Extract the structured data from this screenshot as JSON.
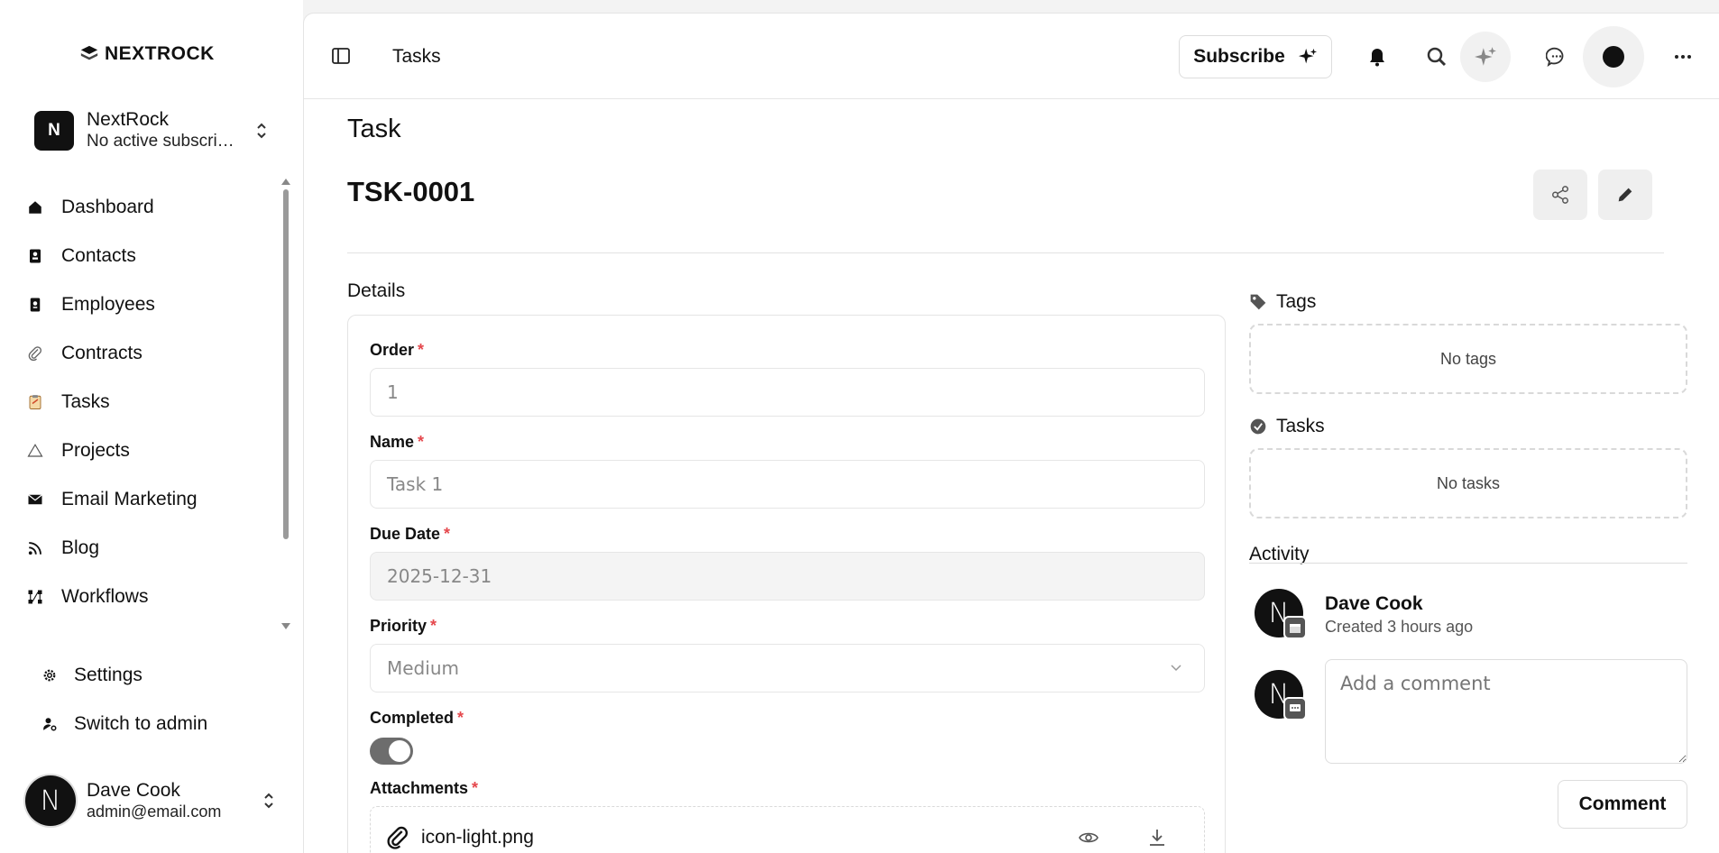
{
  "brand": {
    "name": "NEXTROCK"
  },
  "org": {
    "initial": "N",
    "name": "NextRock",
    "subscription": "No active subscription"
  },
  "nav": [
    {
      "label": "Dashboard",
      "icon": "home-icon"
    },
    {
      "label": "Contacts",
      "icon": "contacts-icon"
    },
    {
      "label": "Employees",
      "icon": "badge-icon"
    },
    {
      "label": "Contracts",
      "icon": "paperclip-icon"
    },
    {
      "label": "Tasks",
      "icon": "clipboard-icon"
    },
    {
      "label": "Projects",
      "icon": "triangle-icon"
    },
    {
      "label": "Email Marketing",
      "icon": "mail-icon"
    },
    {
      "label": "Blog",
      "icon": "rss-icon"
    },
    {
      "label": "Workflows",
      "icon": "workflow-icon"
    }
  ],
  "bottom_nav": [
    {
      "label": "Settings",
      "icon": "gear-icon"
    },
    {
      "label": "Switch to admin",
      "icon": "user-switch-icon"
    }
  ],
  "user": {
    "initial": "N",
    "name": "Dave Cook",
    "email": "admin@email.com"
  },
  "topbar": {
    "breadcrumb": "Tasks",
    "subscribe_label": "Subscribe"
  },
  "page": {
    "section_title": "Task",
    "task_id": "TSK-0001",
    "details_label": "Details"
  },
  "form": {
    "order": {
      "label": "Order",
      "required": "*",
      "value": "1"
    },
    "name": {
      "label": "Name",
      "required": "*",
      "value": "Task 1"
    },
    "due_date": {
      "label": "Due Date",
      "required": "*",
      "value": "2025-12-31"
    },
    "priority": {
      "label": "Priority",
      "required": "*",
      "value": "Medium"
    },
    "completed": {
      "label": "Completed",
      "required": "*",
      "value": true
    },
    "attachments": {
      "label": "Attachments",
      "required": "*",
      "file": "icon-light.png"
    }
  },
  "right": {
    "tags_title": "Tags",
    "tags_empty": "No tags",
    "tasks_title": "Tasks",
    "tasks_empty": "No tasks",
    "activity_title": "Activity",
    "activity": {
      "initial": "N",
      "name": "Dave Cook",
      "action": "Created",
      "time": "3 hours ago"
    },
    "comment_initial": "N",
    "comment_placeholder": "Add a comment",
    "comment_button": "Comment"
  },
  "colors": {
    "accent": "#111111",
    "required": "#e5484d",
    "toggle_on": "#6d6d6d"
  }
}
